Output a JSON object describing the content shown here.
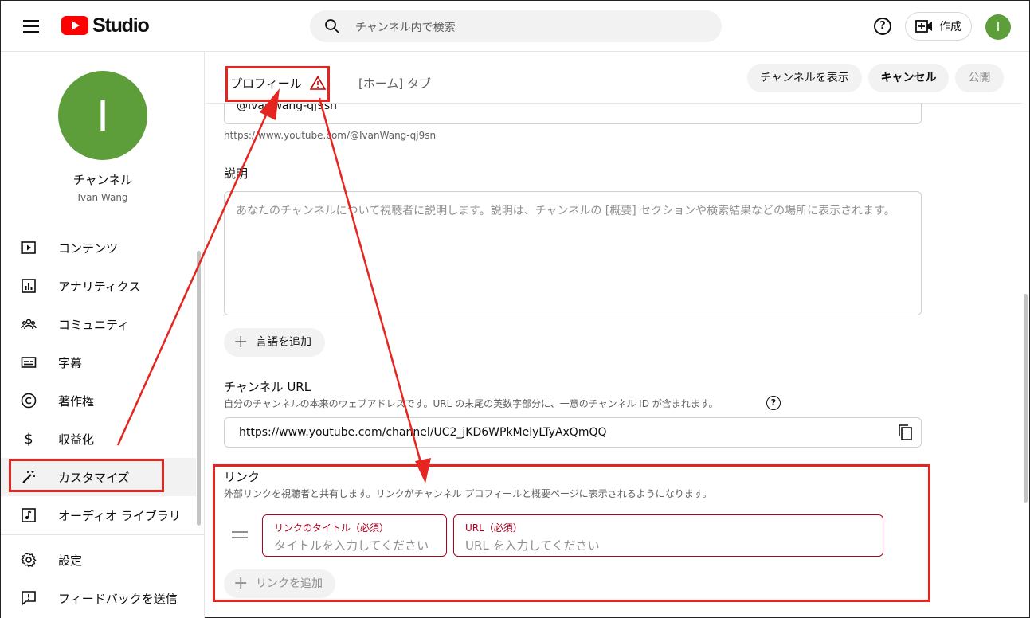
{
  "app": {
    "logo_text": "Studio"
  },
  "search": {
    "placeholder": "チャンネル内で検索"
  },
  "header": {
    "create_label": "作成",
    "avatar_initial": "I",
    "help_symbol": "?"
  },
  "sidebar": {
    "channel_label": "チャンネル",
    "channel_name": "Ivan Wang",
    "avatar_initial": "I",
    "items": [
      {
        "label": "コンテンツ",
        "icon": "content-icon"
      },
      {
        "label": "アナリティクス",
        "icon": "analytics-icon"
      },
      {
        "label": "コミュニティ",
        "icon": "community-icon"
      },
      {
        "label": "字幕",
        "icon": "subtitles-icon"
      },
      {
        "label": "著作権",
        "icon": "copyright-icon"
      },
      {
        "label": "収益化",
        "icon": "monetization-icon"
      },
      {
        "label": "カスタマイズ",
        "icon": "magic-wand-icon",
        "active": true
      },
      {
        "label": "オーディオ ライブラリ",
        "icon": "audio-library-icon"
      }
    ],
    "bottom_items": [
      {
        "label": "設定",
        "icon": "gear-icon"
      },
      {
        "label": "フィードバックを送信",
        "icon": "feedback-icon"
      }
    ]
  },
  "tabs": {
    "profile": "プロフィール",
    "home": "[ホーム] タブ",
    "view_channel": "チャンネルを表示",
    "cancel": "キャンセル",
    "publish": "公開"
  },
  "profile": {
    "handle": "@IvanWang-qj9sn",
    "handle_url": "https://www.youtube.com/@IvanWang-qj9sn",
    "description_label": "説明",
    "description_placeholder": "あなたのチャンネルについて視聴者に説明します。説明は、チャンネルの [概要] セクションや検索結果などの場所に表示されます。",
    "add_language": "言語を追加",
    "channel_url_title": "チャンネル URL",
    "channel_url_desc": "自分のチャンネルの本来のウェブアドレスです。URL の末尾の英数字部分に、一意のチャンネル ID が含まれます。",
    "channel_url_value": "https://www.youtube.com/channel/UC2_jKD6WPkMelyLTyAxQmQQ",
    "links_title": "リンク",
    "links_desc": "外部リンクを視聴者と共有します。リンクがチャンネル プロフィールと概要ページに表示されるようになります。",
    "link_title_label": "リンクのタイトル（必須）",
    "link_title_placeholder": "タイトルを入力してください",
    "link_url_label": "URL（必須）",
    "link_url_placeholder": "URL を入力してください",
    "add_link": "リンクを追加"
  },
  "colors": {
    "brand_red": "#ff0000",
    "avatar_green": "#5d9d3a",
    "annotation_red": "#e52620",
    "required_red": "#b00020"
  }
}
